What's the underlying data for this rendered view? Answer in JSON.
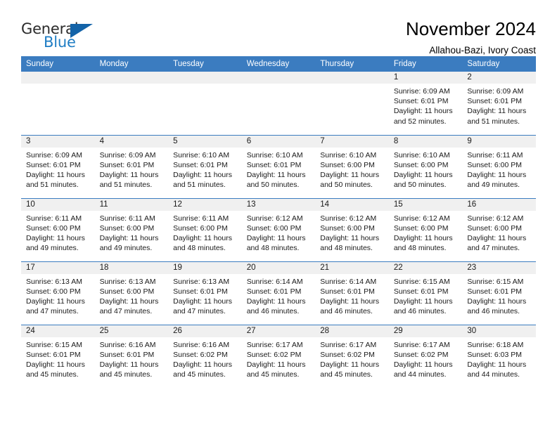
{
  "brand": {
    "name_part1": "General",
    "name_part2": "Blue",
    "logo_icon": "blue-triangle-logo"
  },
  "header": {
    "title": "November 2024",
    "subtitle": "Allahou-Bazi, Ivory Coast"
  },
  "calendar": {
    "weekday_headers": [
      "Sunday",
      "Monday",
      "Tuesday",
      "Wednesday",
      "Thursday",
      "Friday",
      "Saturday"
    ],
    "colors": {
      "header_blue": "#3b7cc0",
      "daynum_gray": "#f0f0f0",
      "brand_blue": "#1f7dc4",
      "logo_blue": "#1363a8"
    },
    "weeks": [
      [
        {
          "day": "",
          "blank": true,
          "sunrise": "",
          "sunset": "",
          "daylight": ""
        },
        {
          "day": "",
          "blank": true,
          "sunrise": "",
          "sunset": "",
          "daylight": ""
        },
        {
          "day": "",
          "blank": true,
          "sunrise": "",
          "sunset": "",
          "daylight": ""
        },
        {
          "day": "",
          "blank": true,
          "sunrise": "",
          "sunset": "",
          "daylight": ""
        },
        {
          "day": "",
          "blank": true,
          "sunrise": "",
          "sunset": "",
          "daylight": ""
        },
        {
          "day": "1",
          "blank": false,
          "sunrise": "Sunrise: 6:09 AM",
          "sunset": "Sunset: 6:01 PM",
          "daylight": "Daylight: 11 hours and 52 minutes."
        },
        {
          "day": "2",
          "blank": false,
          "sunrise": "Sunrise: 6:09 AM",
          "sunset": "Sunset: 6:01 PM",
          "daylight": "Daylight: 11 hours and 51 minutes."
        }
      ],
      [
        {
          "day": "3",
          "blank": false,
          "sunrise": "Sunrise: 6:09 AM",
          "sunset": "Sunset: 6:01 PM",
          "daylight": "Daylight: 11 hours and 51 minutes."
        },
        {
          "day": "4",
          "blank": false,
          "sunrise": "Sunrise: 6:09 AM",
          "sunset": "Sunset: 6:01 PM",
          "daylight": "Daylight: 11 hours and 51 minutes."
        },
        {
          "day": "5",
          "blank": false,
          "sunrise": "Sunrise: 6:10 AM",
          "sunset": "Sunset: 6:01 PM",
          "daylight": "Daylight: 11 hours and 51 minutes."
        },
        {
          "day": "6",
          "blank": false,
          "sunrise": "Sunrise: 6:10 AM",
          "sunset": "Sunset: 6:01 PM",
          "daylight": "Daylight: 11 hours and 50 minutes."
        },
        {
          "day": "7",
          "blank": false,
          "sunrise": "Sunrise: 6:10 AM",
          "sunset": "Sunset: 6:00 PM",
          "daylight": "Daylight: 11 hours and 50 minutes."
        },
        {
          "day": "8",
          "blank": false,
          "sunrise": "Sunrise: 6:10 AM",
          "sunset": "Sunset: 6:00 PM",
          "daylight": "Daylight: 11 hours and 50 minutes."
        },
        {
          "day": "9",
          "blank": false,
          "sunrise": "Sunrise: 6:11 AM",
          "sunset": "Sunset: 6:00 PM",
          "daylight": "Daylight: 11 hours and 49 minutes."
        }
      ],
      [
        {
          "day": "10",
          "blank": false,
          "sunrise": "Sunrise: 6:11 AM",
          "sunset": "Sunset: 6:00 PM",
          "daylight": "Daylight: 11 hours and 49 minutes."
        },
        {
          "day": "11",
          "blank": false,
          "sunrise": "Sunrise: 6:11 AM",
          "sunset": "Sunset: 6:00 PM",
          "daylight": "Daylight: 11 hours and 49 minutes."
        },
        {
          "day": "12",
          "blank": false,
          "sunrise": "Sunrise: 6:11 AM",
          "sunset": "Sunset: 6:00 PM",
          "daylight": "Daylight: 11 hours and 48 minutes."
        },
        {
          "day": "13",
          "blank": false,
          "sunrise": "Sunrise: 6:12 AM",
          "sunset": "Sunset: 6:00 PM",
          "daylight": "Daylight: 11 hours and 48 minutes."
        },
        {
          "day": "14",
          "blank": false,
          "sunrise": "Sunrise: 6:12 AM",
          "sunset": "Sunset: 6:00 PM",
          "daylight": "Daylight: 11 hours and 48 minutes."
        },
        {
          "day": "15",
          "blank": false,
          "sunrise": "Sunrise: 6:12 AM",
          "sunset": "Sunset: 6:00 PM",
          "daylight": "Daylight: 11 hours and 48 minutes."
        },
        {
          "day": "16",
          "blank": false,
          "sunrise": "Sunrise: 6:12 AM",
          "sunset": "Sunset: 6:00 PM",
          "daylight": "Daylight: 11 hours and 47 minutes."
        }
      ],
      [
        {
          "day": "17",
          "blank": false,
          "sunrise": "Sunrise: 6:13 AM",
          "sunset": "Sunset: 6:00 PM",
          "daylight": "Daylight: 11 hours and 47 minutes."
        },
        {
          "day": "18",
          "blank": false,
          "sunrise": "Sunrise: 6:13 AM",
          "sunset": "Sunset: 6:00 PM",
          "daylight": "Daylight: 11 hours and 47 minutes."
        },
        {
          "day": "19",
          "blank": false,
          "sunrise": "Sunrise: 6:13 AM",
          "sunset": "Sunset: 6:01 PM",
          "daylight": "Daylight: 11 hours and 47 minutes."
        },
        {
          "day": "20",
          "blank": false,
          "sunrise": "Sunrise: 6:14 AM",
          "sunset": "Sunset: 6:01 PM",
          "daylight": "Daylight: 11 hours and 46 minutes."
        },
        {
          "day": "21",
          "blank": false,
          "sunrise": "Sunrise: 6:14 AM",
          "sunset": "Sunset: 6:01 PM",
          "daylight": "Daylight: 11 hours and 46 minutes."
        },
        {
          "day": "22",
          "blank": false,
          "sunrise": "Sunrise: 6:15 AM",
          "sunset": "Sunset: 6:01 PM",
          "daylight": "Daylight: 11 hours and 46 minutes."
        },
        {
          "day": "23",
          "blank": false,
          "sunrise": "Sunrise: 6:15 AM",
          "sunset": "Sunset: 6:01 PM",
          "daylight": "Daylight: 11 hours and 46 minutes."
        }
      ],
      [
        {
          "day": "24",
          "blank": false,
          "sunrise": "Sunrise: 6:15 AM",
          "sunset": "Sunset: 6:01 PM",
          "daylight": "Daylight: 11 hours and 45 minutes."
        },
        {
          "day": "25",
          "blank": false,
          "sunrise": "Sunrise: 6:16 AM",
          "sunset": "Sunset: 6:01 PM",
          "daylight": "Daylight: 11 hours and 45 minutes."
        },
        {
          "day": "26",
          "blank": false,
          "sunrise": "Sunrise: 6:16 AM",
          "sunset": "Sunset: 6:02 PM",
          "daylight": "Daylight: 11 hours and 45 minutes."
        },
        {
          "day": "27",
          "blank": false,
          "sunrise": "Sunrise: 6:17 AM",
          "sunset": "Sunset: 6:02 PM",
          "daylight": "Daylight: 11 hours and 45 minutes."
        },
        {
          "day": "28",
          "blank": false,
          "sunrise": "Sunrise: 6:17 AM",
          "sunset": "Sunset: 6:02 PM",
          "daylight": "Daylight: 11 hours and 45 minutes."
        },
        {
          "day": "29",
          "blank": false,
          "sunrise": "Sunrise: 6:17 AM",
          "sunset": "Sunset: 6:02 PM",
          "daylight": "Daylight: 11 hours and 44 minutes."
        },
        {
          "day": "30",
          "blank": false,
          "sunrise": "Sunrise: 6:18 AM",
          "sunset": "Sunset: 6:03 PM",
          "daylight": "Daylight: 11 hours and 44 minutes."
        }
      ]
    ]
  }
}
